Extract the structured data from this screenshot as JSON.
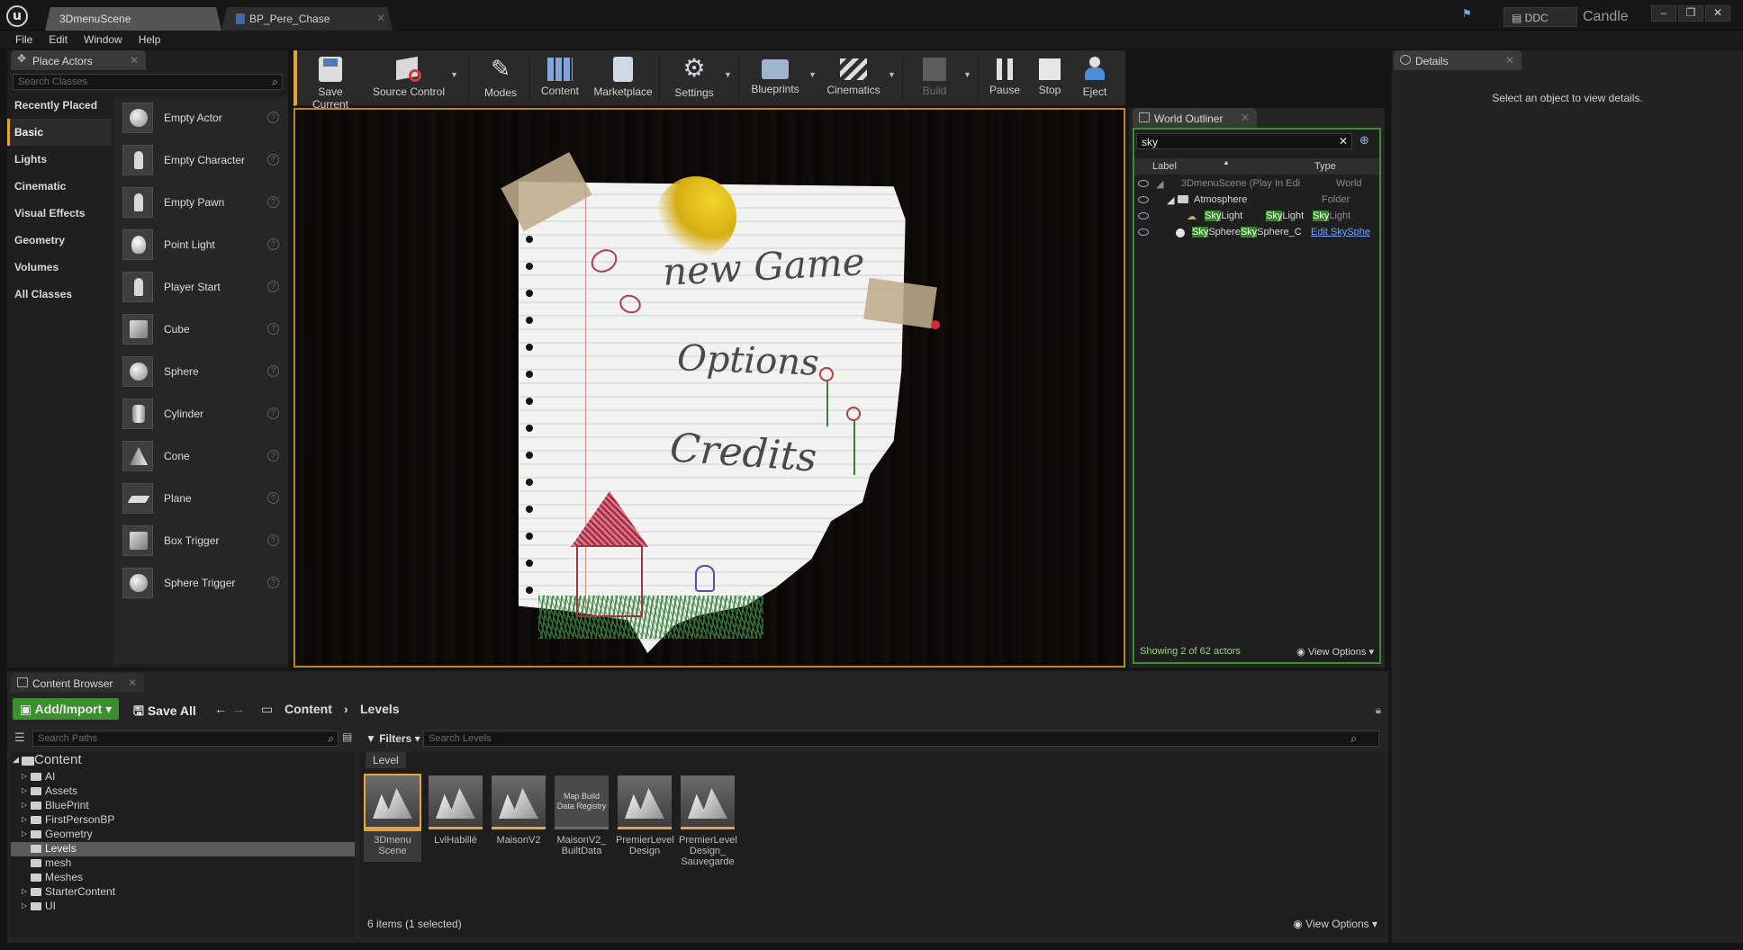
{
  "titlebar": {
    "tabs": [
      {
        "label": "3DmenuScene",
        "active": true
      },
      {
        "label": "BP_Pere_Chase",
        "active": false
      }
    ],
    "ddc_label": "DDC",
    "project_name": "Candle"
  },
  "menubar": {
    "items": [
      "File",
      "Edit",
      "Window",
      "Help"
    ]
  },
  "place_actors": {
    "tab_label": "Place Actors",
    "search_placeholder": "Search Classes",
    "categories": [
      "Recently Placed",
      "Basic",
      "Lights",
      "Cinematic",
      "Visual Effects",
      "Geometry",
      "Volumes",
      "All Classes"
    ],
    "active_category": "Basic",
    "actors": [
      "Empty Actor",
      "Empty Character",
      "Empty Pawn",
      "Point Light",
      "Player Start",
      "Cube",
      "Sphere",
      "Cylinder",
      "Cone",
      "Plane",
      "Box Trigger",
      "Sphere Trigger"
    ]
  },
  "toolbar": {
    "buttons": [
      "Save Current",
      "Source Control",
      "Modes",
      "Content",
      "Marketplace",
      "Settings",
      "Blueprints",
      "Cinematics",
      "Build",
      "Pause",
      "Stop",
      "Eject"
    ]
  },
  "viewport": {
    "menu_items": [
      "new Game",
      "Options",
      "Credits"
    ]
  },
  "world_outliner": {
    "tab_label": "World Outliner",
    "search_value": "sky",
    "col_label": "Label",
    "col_type": "Type",
    "rows": [
      {
        "label": "3DmenuScene (Play In Edi",
        "type": "World"
      },
      {
        "label": "Atmosphere",
        "type": "Folder"
      },
      {
        "label": "SkyLight",
        "type": "SkyLight"
      },
      {
        "label": "SkySphere",
        "type": "SkySphere_C"
      }
    ],
    "skylight_label_parts": [
      "Sky",
      "Light"
    ],
    "skylight_type_parts": [
      "Sky",
      "Light"
    ],
    "skysphere_label_parts": [
      "Sky",
      "Sphere"
    ],
    "skysphere_type_parts": [
      "Sky",
      "Sphere_C"
    ],
    "skysphere_link": "Edit SkySphe",
    "footer": "Showing 2 of 62 actors",
    "view_options": "View Options"
  },
  "details": {
    "tab_label": "Details",
    "empty_message": "Select an object to view details."
  },
  "content_browser": {
    "tab_label": "Content Browser",
    "add_import": "Add/Import",
    "save_all": "Save All",
    "breadcrumb": [
      "Content",
      "Levels"
    ],
    "search_paths_placeholder": "Search Paths",
    "filters_label": "Filters",
    "search_levels_placeholder": "Search Levels",
    "filter_chip": "Level",
    "tree": {
      "root": "Content",
      "items": [
        "AI",
        "Assets",
        "BluePrint",
        "FirstPersonBP",
        "Geometry",
        "Levels",
        "mesh",
        "Meshes",
        "StarterContent",
        "UI"
      ],
      "selected": "Levels"
    },
    "assets": [
      {
        "label": "3Dmenu Scene",
        "selected": true,
        "kind": "level"
      },
      {
        "label": "LvlHabillé",
        "selected": false,
        "kind": "level"
      },
      {
        "label": "MaisonV2",
        "selected": false,
        "kind": "level"
      },
      {
        "label": "MaisonV2_ BuiltData",
        "selected": false,
        "kind": "registry"
      },
      {
        "label": "PremierLevel Design",
        "selected": false,
        "kind": "level"
      },
      {
        "label": "PremierLevel Design_ Sauvegarde",
        "selected": false,
        "kind": "level"
      }
    ],
    "registry_thumb_text": "Map Build Data Registry",
    "status": "6 items (1 selected)",
    "view_options": "View Options"
  },
  "colors": {
    "accent": "#e8a33d",
    "outliner_border": "#3a8f2f",
    "highlight": "#2b8a1f"
  }
}
